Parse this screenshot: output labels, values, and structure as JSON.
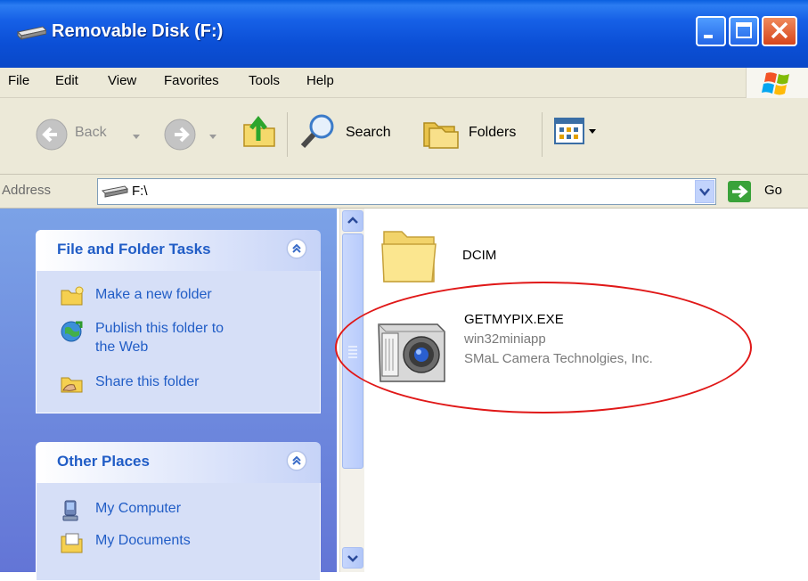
{
  "window": {
    "title": "Removable Disk (F:)"
  },
  "menu": [
    "File",
    "Edit",
    "View",
    "Favorites",
    "Tools",
    "Help"
  ],
  "toolbar": {
    "back": "Back",
    "search": "Search",
    "folders": "Folders"
  },
  "address": {
    "label": "Address",
    "value": "F:\\",
    "go": "Go"
  },
  "tasks_panel": {
    "title": "File and Folder Tasks",
    "items": [
      {
        "label": "Make a new folder",
        "icon": "new-folder-icon"
      },
      {
        "label": "Publish this folder to",
        "label2": "the Web",
        "icon": "publish-web-icon"
      },
      {
        "label": "Share this folder",
        "icon": "share-folder-icon"
      }
    ]
  },
  "places_panel": {
    "title": "Other Places",
    "items": [
      {
        "label": "My Computer",
        "icon": "my-computer-icon"
      },
      {
        "label": "My Documents",
        "icon": "my-documents-icon"
      }
    ]
  },
  "files": [
    {
      "name": "DCIM",
      "icon": "folder-icon"
    },
    {
      "name": "GETMYPIX.EXE",
      "line2": "win32miniapp",
      "line3": "SMaL Camera Technolgies, Inc.",
      "icon": "camera-icon"
    }
  ],
  "colors": {
    "title_blue": "#0b4fd6",
    "pane_blue": "#6375d6",
    "link_blue": "#215dc6",
    "highlight_red": "#e01818"
  }
}
